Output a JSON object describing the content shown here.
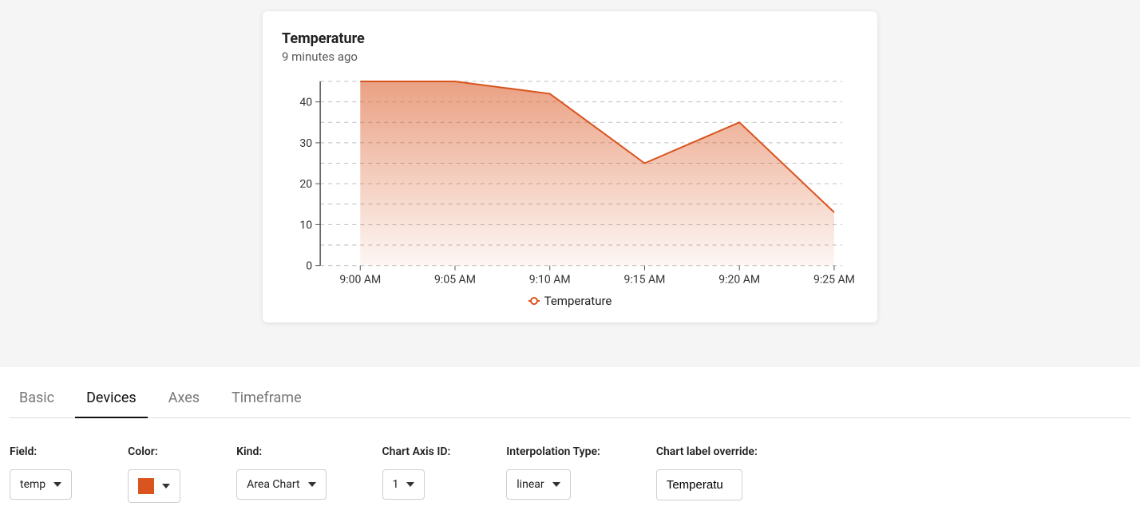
{
  "card": {
    "title": "Temperature",
    "subtitle": "9 minutes ago",
    "legend": "Temperature"
  },
  "chart_data": {
    "type": "area",
    "title": "Temperature",
    "xlabel": "",
    "ylabel": "",
    "ylim": [
      0,
      45
    ],
    "y_ticks": [
      0,
      10,
      20,
      30,
      40
    ],
    "categories": [
      "9:00 AM",
      "9:05 AM",
      "9:10 AM",
      "9:15 AM",
      "9:20 AM",
      "9:25 AM"
    ],
    "series": [
      {
        "name": "Temperature",
        "values": [
          45,
          45,
          42,
          25,
          35,
          13
        ],
        "color": "#d9541e"
      }
    ]
  },
  "tabs": [
    {
      "id": "basic",
      "label": "Basic",
      "active": false
    },
    {
      "id": "devices",
      "label": "Devices",
      "active": true
    },
    {
      "id": "axes",
      "label": "Axes",
      "active": false
    },
    {
      "id": "timeframe",
      "label": "Timeframe",
      "active": false
    }
  ],
  "form": {
    "field": {
      "label": "Field:",
      "value": "temp"
    },
    "color": {
      "label": "Color:",
      "value": "#d9541e"
    },
    "kind": {
      "label": "Kind:",
      "value": "Area Chart"
    },
    "axis_id": {
      "label": "Chart Axis ID:",
      "value": "1"
    },
    "interpolation": {
      "label": "Interpolation Type:",
      "value": "linear"
    },
    "label_override": {
      "label": "Chart label override:",
      "value": "Temperatu"
    }
  }
}
